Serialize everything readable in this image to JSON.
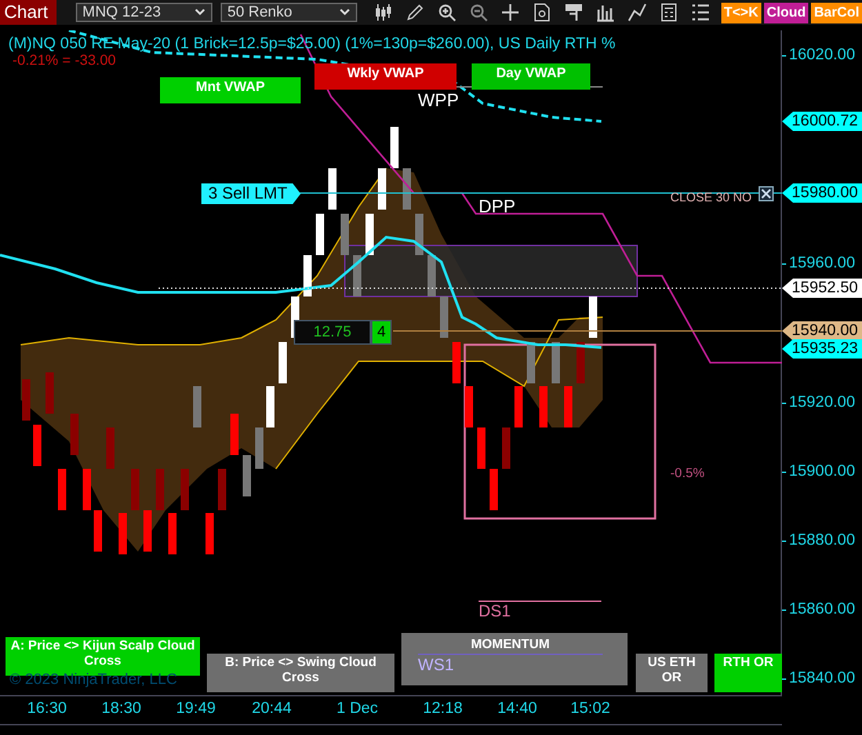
{
  "toolbar": {
    "title": "Chart",
    "instrument": "MNQ 12-23",
    "bar_type": "50 Renko",
    "tool_buttons": [
      {
        "label": "T<>K",
        "color": "#ff8c00"
      },
      {
        "label": "Cloud",
        "color": "#c01e96"
      },
      {
        "label": "BarCol",
        "color": "#ff8c00"
      }
    ]
  },
  "chart": {
    "title": "(M)NQ 050 RE May-20 (1 Brick=12.5p=$25.00) (1%=130p=$260.00), US Daily RTH %",
    "change": "-0.21% = -33.00",
    "vwap_buttons": [
      {
        "label": "Mnt VWAP",
        "color": "#00d000"
      },
      {
        "label": "Wkly VWAP",
        "color": "#d00000"
      },
      {
        "label": "Day VWAP",
        "color": "#00c000"
      }
    ],
    "level_labels": [
      "WPP",
      "DPP",
      "DS1",
      "-0.5%"
    ],
    "order_label": "3 Sell LMT",
    "close_label": "CLOSE 30 NO",
    "position": {
      "value": "12.75",
      "quantity": "4"
    },
    "panel_buttons": [
      {
        "label": "A: Price <> Kijun Scalp Cloud Cross",
        "color": "#00d000"
      },
      {
        "label": "B: Price <> Swing Cloud Cross",
        "color": "#6e6e6e"
      },
      {
        "label": "US ETH OR",
        "color": "#6e6e6e"
      },
      {
        "label": "RTH OR",
        "color": "#00d000"
      }
    ],
    "momentum": {
      "title": "MOMENTUM",
      "level": "WS1"
    },
    "copyright": "© 2023 NinjaTrader, LLC"
  },
  "price_axis": {
    "ticks": [
      "16020.00",
      "15960.00",
      "15920.00",
      "15900.00",
      "15880.00",
      "15860.00",
      "15840.00"
    ],
    "markers": [
      {
        "value": "16000.72",
        "color": "#00ffff"
      },
      {
        "value": "15980.00",
        "color": "#00ffff"
      },
      {
        "value": "15952.50",
        "color": "#ffffff"
      },
      {
        "value": "15940.00",
        "color": "#deb887"
      },
      {
        "value": "15935.23",
        "color": "#00ffff"
      }
    ]
  },
  "time_axis": [
    "16:30",
    "18:30",
    "19:49",
    "20:44",
    "1 Dec",
    "12:18",
    "14:40",
    "15:02"
  ]
}
